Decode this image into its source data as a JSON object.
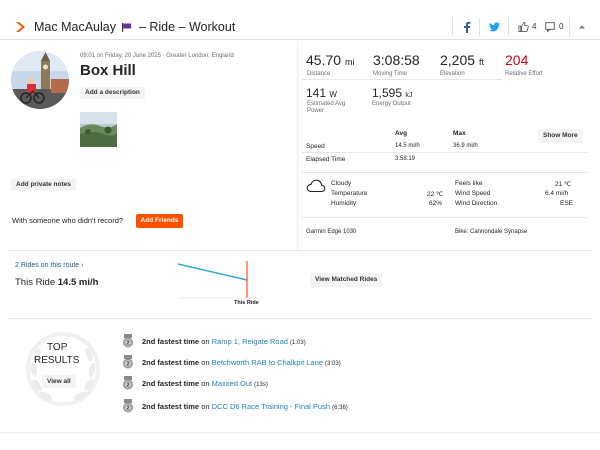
{
  "header": {
    "athlete": "Mac MacAulay",
    "title_suffix": "– Ride – Workout",
    "kudos_count": "4",
    "comments_count": "0",
    "colors": {
      "brand": "#fc5200",
      "facebook": "#3b5998",
      "twitter": "#1da1f2",
      "flag": "#6b2fa3"
    }
  },
  "activity": {
    "datetime": "09:01 on Friday, 20 June 2025 · Greater London, England",
    "name": "Box Hill",
    "add_description": "Add a description",
    "add_private_notes": "Add private notes",
    "friends_prompt": "With someone who didn't record?",
    "add_friends": "Add Friends"
  },
  "stats": {
    "distance": {
      "value": "45.70",
      "unit": "mi",
      "label": "Distance"
    },
    "moving_time": {
      "value": "3:08:58",
      "label": "Moving Time"
    },
    "elevation": {
      "value": "2,205",
      "unit": "ft",
      "label": "Elevation"
    },
    "relative_effort": {
      "value": "204",
      "label": "Relative Effort",
      "color": "#d0021b"
    },
    "avg_power": {
      "value": "141",
      "unit": "W",
      "label": "Estimated Avg Power"
    },
    "energy": {
      "value": "1,595",
      "unit": "kJ",
      "label": "Energy Output"
    }
  },
  "table": {
    "col_avg": "Avg",
    "col_max": "Max",
    "show_more": "Show More",
    "speed_label": "Speed",
    "speed_avg": "14.5 mi/h",
    "speed_max": "36.9 mi/h",
    "elapsed_label": "Elapsed Time",
    "elapsed_value": "3:58:19"
  },
  "weather": {
    "condition": "Cloudy",
    "temperature_label": "Temperature",
    "temperature_value": "22 ℃",
    "humidity_label": "Humidity",
    "humidity_value": "62%",
    "feels_like_label": "Feels like",
    "feels_like_value": "21 ℃",
    "wind_speed_label": "Wind Speed",
    "wind_speed_value": "6.4 mi/h",
    "wind_direction_label": "Wind Direction",
    "wind_direction_value": "ESE"
  },
  "gear": {
    "device": "Garmin Edge 1030",
    "bike": "Bike: Cannondale Synapse"
  },
  "route": {
    "rides_link": "2 Rides on this route ›",
    "this_ride_label": "This Ride",
    "this_ride_speed": "14.5 mi/h",
    "chart_marker_label": "This Ride",
    "view_matched": "View Matched Rides"
  },
  "top_results": {
    "title_line1": "TOP",
    "title_line2": "RESULTS",
    "view_all": "View all"
  },
  "achievements": [
    {
      "rank": "2",
      "prefix": "2nd fastest time",
      "on": "on",
      "segment": "Ramp 1, Reigate Road",
      "time": "(1:03)"
    },
    {
      "rank": "2",
      "prefix": "2nd fastest time",
      "on": "on",
      "segment": "Betchworth RAB to Chalkpit Lane",
      "time": "(3:03)"
    },
    {
      "rank": "2",
      "prefix": "2nd fastest time",
      "on": "on",
      "segment": "Maxxed Out",
      "time": "(13s)"
    },
    {
      "rank": "2",
      "prefix": "2nd fastest time",
      "on": "on",
      "segment": "DCC D6 Race Training - Final Push",
      "time": "(6:36)"
    }
  ]
}
